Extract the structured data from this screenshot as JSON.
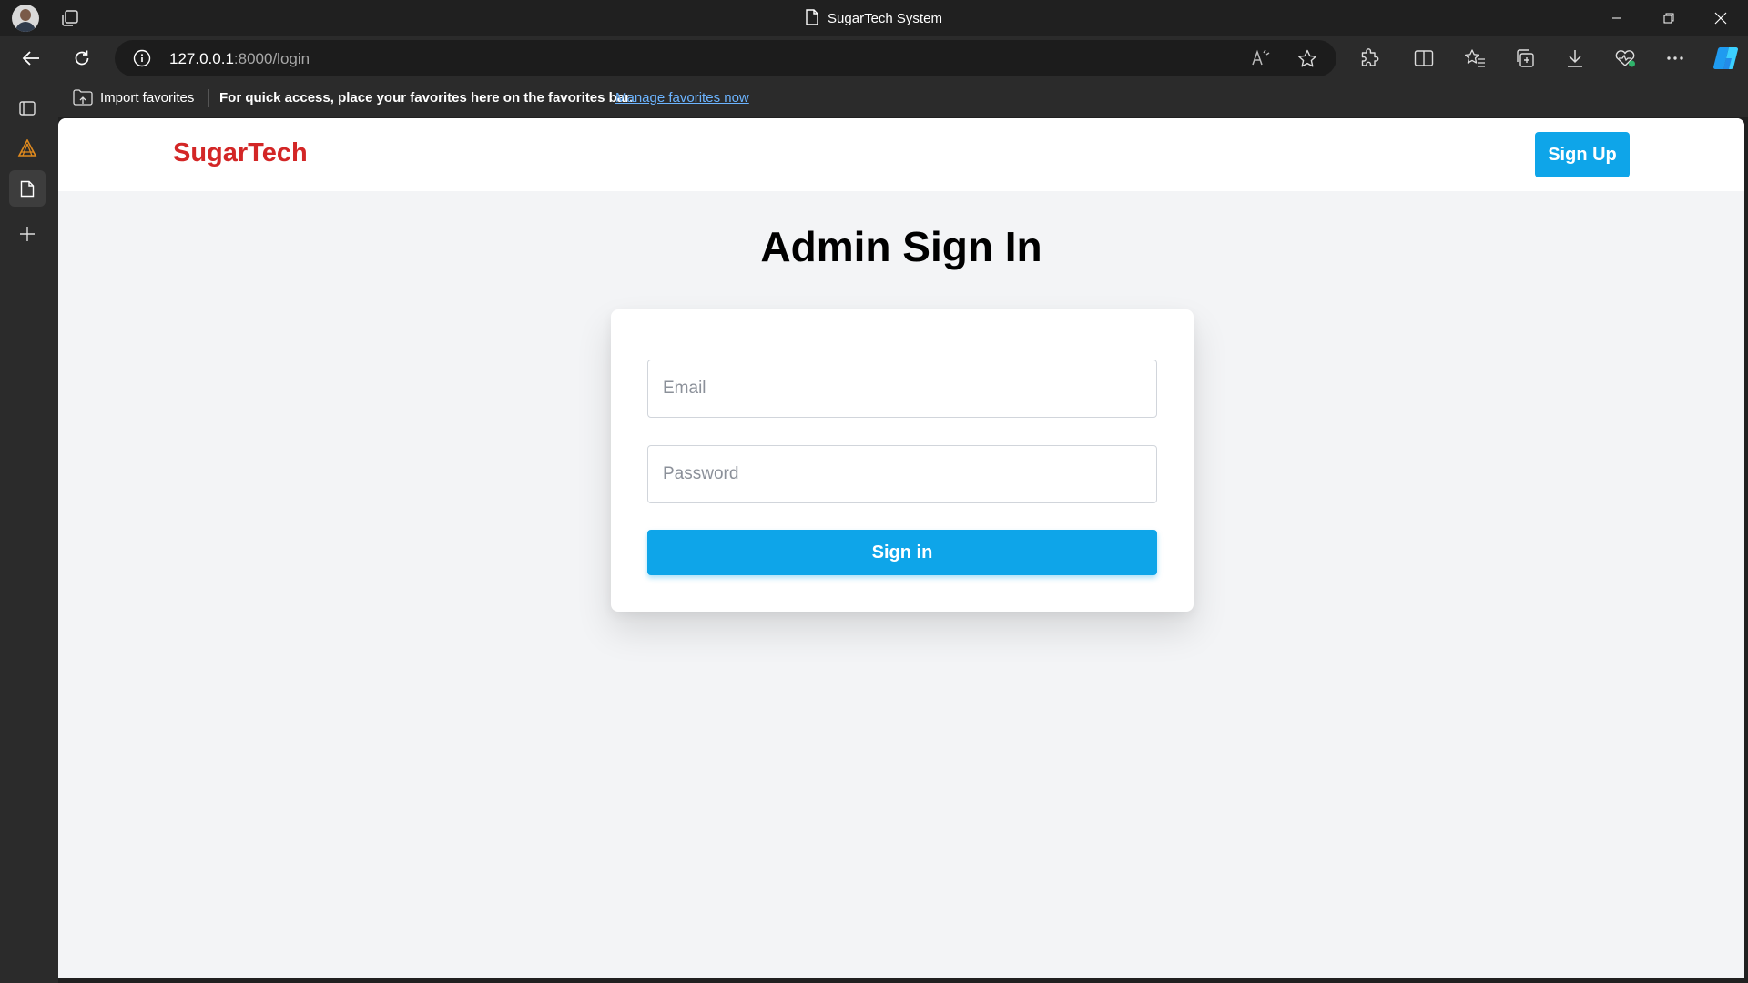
{
  "window": {
    "title": "SugarTech System"
  },
  "browser": {
    "url_host": "127.0.0.1",
    "url_path": ":8000/login",
    "favorites_bar": {
      "import_label": "Import favorites",
      "message": "For quick access, place your favorites here on the favorites bar.",
      "manage_link": "Manage favorites now"
    },
    "icons": [
      "profile-avatar",
      "tab-actions-icon",
      "back-icon",
      "refresh-icon",
      "info-icon",
      "read-aloud-icon",
      "favorite-star-icon",
      "extensions-icon",
      "split-screen-icon",
      "favorites-icon",
      "collections-icon",
      "downloads-icon",
      "browser-essentials-icon",
      "more-icon",
      "copilot-icon"
    ]
  },
  "site": {
    "brand": "SugarTech",
    "signup_label": "Sign Up",
    "heading": "Admin Sign In",
    "form": {
      "email_placeholder": "Email",
      "email_value": "",
      "password_placeholder": "Password",
      "password_value": "",
      "submit_label": "Sign in"
    }
  },
  "colors": {
    "brand": "#d32626",
    "accent": "#0ea5e9",
    "page_bg": "#f3f4f6"
  }
}
